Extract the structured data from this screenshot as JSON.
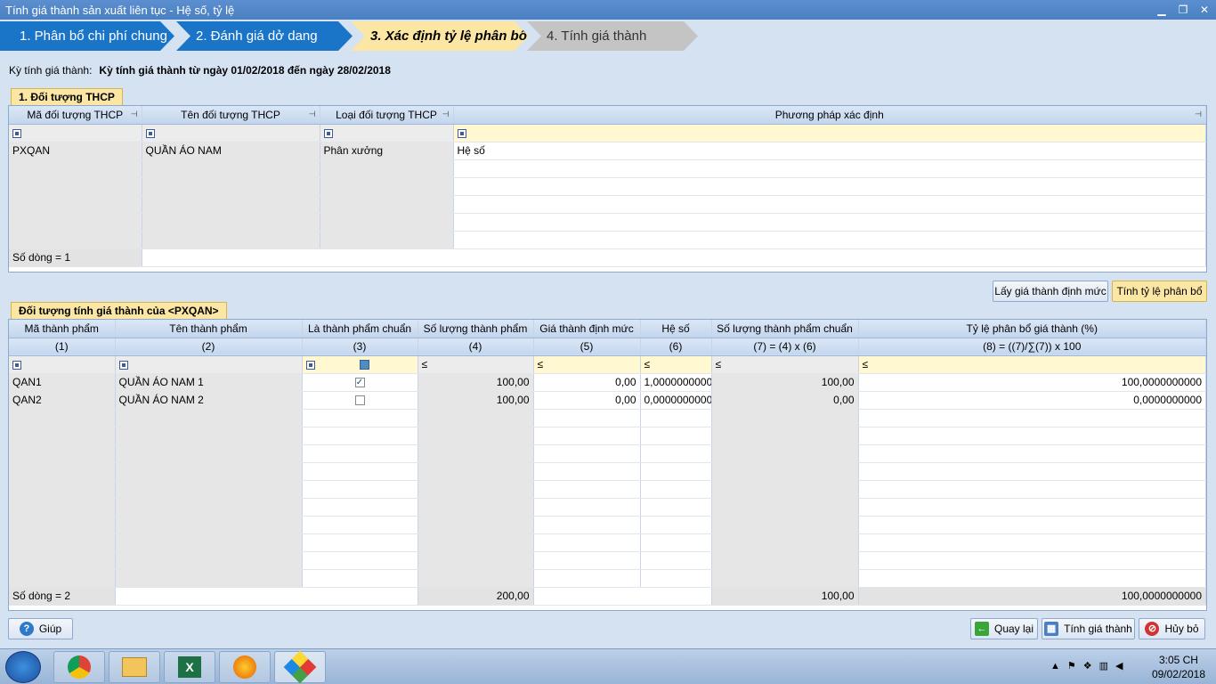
{
  "window": {
    "title": "Tính giá thành sản xuất liên tục - Hệ số, tỷ lệ"
  },
  "wizard": {
    "steps": [
      {
        "label": "1. Phân bổ chi phí chung"
      },
      {
        "label": "2. Đánh giá dở dang"
      },
      {
        "label": "3. Xác định tỷ lệ phân bổ"
      },
      {
        "label": "4. Tính giá thành"
      }
    ]
  },
  "period": {
    "label": "Kỳ tính giá thành:",
    "value": "Kỳ tính giá thành từ ngày 01/02/2018 đến ngày 28/02/2018"
  },
  "group1": {
    "tab": "1. Đối tượng THCP",
    "columns": [
      "Mã đối tượng THCP",
      "Tên đối tượng THCP",
      "Loại đối tượng THCP",
      "Phương pháp xác định"
    ],
    "rows": [
      [
        "PXQAN",
        "QUẦN ÁO NAM",
        "Phân xưởng",
        "Hệ số"
      ]
    ],
    "footer": "Số dòng = 1"
  },
  "buttons": {
    "get_standard": "Lấy giá thành định mức",
    "calc_ratio": "Tính tỷ lệ phân bổ"
  },
  "group2": {
    "tab": "Đối tượng tính giá thành của <PXQAN>",
    "columns": [
      "Mã thành phẩm",
      "Tên thành phẩm",
      "Là thành phẩm chuẩn",
      "Số lượng thành phẩm",
      "Giá thành định mức",
      "Hệ số",
      "Số lượng thành phẩm chuẩn",
      "Tỷ lệ phân bổ giá thành (%)"
    ],
    "subheaders": [
      "(1)",
      "(2)",
      "(3)",
      "(4)",
      "(5)",
      "(6)",
      "(7) = (4) x (6)",
      "(8) = ((7)/∑(7)) x 100"
    ],
    "filter_op": "≤",
    "rows": [
      {
        "code": "QAN1",
        "name": "QUẦN ÁO NAM 1",
        "standard": true,
        "qty": "100,00",
        "std_cost": "0,00",
        "coef": "1,0000000000",
        "std_qty": "100,00",
        "ratio": "100,0000000000"
      },
      {
        "code": "QAN2",
        "name": "QUẦN ÁO NAM 2",
        "standard": false,
        "qty": "100,00",
        "std_cost": "0,00",
        "coef": "0,0000000000",
        "std_qty": "0,00",
        "ratio": "0,0000000000"
      }
    ],
    "footer": {
      "count": "Số dòng = 2",
      "qty": "200,00",
      "std_qty": "100,00",
      "ratio": "100,0000000000"
    }
  },
  "bottom": {
    "help": "Giúp",
    "back": "Quay lại",
    "compute": "Tính giá thành",
    "cancel": "Hủy bỏ"
  },
  "taskbar": {
    "time": "3:05 CH",
    "date": "09/02/2018"
  }
}
